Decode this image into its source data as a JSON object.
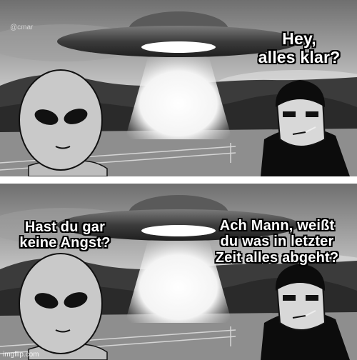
{
  "panels": [
    {
      "captions": [
        "Hey,\nalles klar?"
      ],
      "watermark": "@cmar"
    },
    {
      "captions": [
        "Hast du gar\nkeine Angst?",
        "Ach Mann, weißt\ndu was in letzter\nZeit alles abgeht?"
      ],
      "credit": "imgflip.com"
    }
  ],
  "colors": {
    "sky": "#bdbdbd",
    "ufo": "#4a4a4a",
    "beam": "#ffffff",
    "hills": "#3a3a3a",
    "field": "#9a9a9a",
    "alien": "#c9c9c9",
    "hoodie": "#0c0c0c"
  },
  "icons": [
    "ufo-icon",
    "alien-icon",
    "doomer-icon"
  ]
}
